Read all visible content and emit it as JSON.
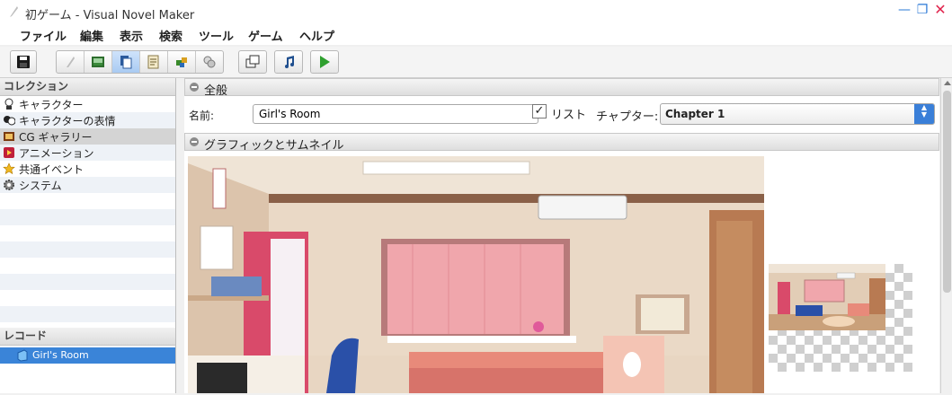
{
  "window": {
    "title": "初ゲーム - Visual Novel Maker"
  },
  "menu": {
    "items": [
      "ファイル",
      "編集",
      "表示",
      "検索",
      "ツール",
      "ゲーム",
      "ヘルプ"
    ]
  },
  "toolbar": {
    "buttons": [
      {
        "name": "save",
        "icon": "floppy-icon"
      },
      {
        "name": "pen",
        "icon": "pen-icon"
      },
      {
        "name": "image",
        "icon": "image-icon"
      },
      {
        "name": "gallery",
        "icon": "gallery-icon",
        "active": true
      },
      {
        "name": "script",
        "icon": "script-icon"
      },
      {
        "name": "puzzle",
        "icon": "puzzle-icon"
      },
      {
        "name": "masks",
        "icon": "masks-icon"
      },
      {
        "name": "windows",
        "icon": "windows-icon"
      },
      {
        "name": "music",
        "icon": "music-icon"
      },
      {
        "name": "play",
        "icon": "play-icon"
      }
    ]
  },
  "collection": {
    "header": "コレクション",
    "items": [
      {
        "label": "キャラクター",
        "icon": "character-icon"
      },
      {
        "label": "キャラクターの表情",
        "icon": "expression-icon"
      },
      {
        "label": "CG ギャラリー",
        "icon": "cg-gallery-icon",
        "selected": true
      },
      {
        "label": "アニメーション",
        "icon": "animation-icon"
      },
      {
        "label": "共通イベント",
        "icon": "star-icon"
      },
      {
        "label": "システム",
        "icon": "gear-icon"
      }
    ]
  },
  "records": {
    "header": "レコード",
    "items": [
      {
        "label": "Girl's Room",
        "icon": "record-icon",
        "selected": true
      }
    ]
  },
  "general": {
    "header": "全般",
    "name_label": "名前:",
    "name_value": "Girl's Room",
    "list_checked": true,
    "list_label": "リスト",
    "chapter_label": "チャプター:",
    "chapter_value": "Chapter 1"
  },
  "graphics": {
    "header": "グラフィックとサムネイル"
  },
  "colors": {
    "accent": "#3a84d8",
    "select_arrow": "#3a7fd8",
    "close": "#e0244d"
  }
}
